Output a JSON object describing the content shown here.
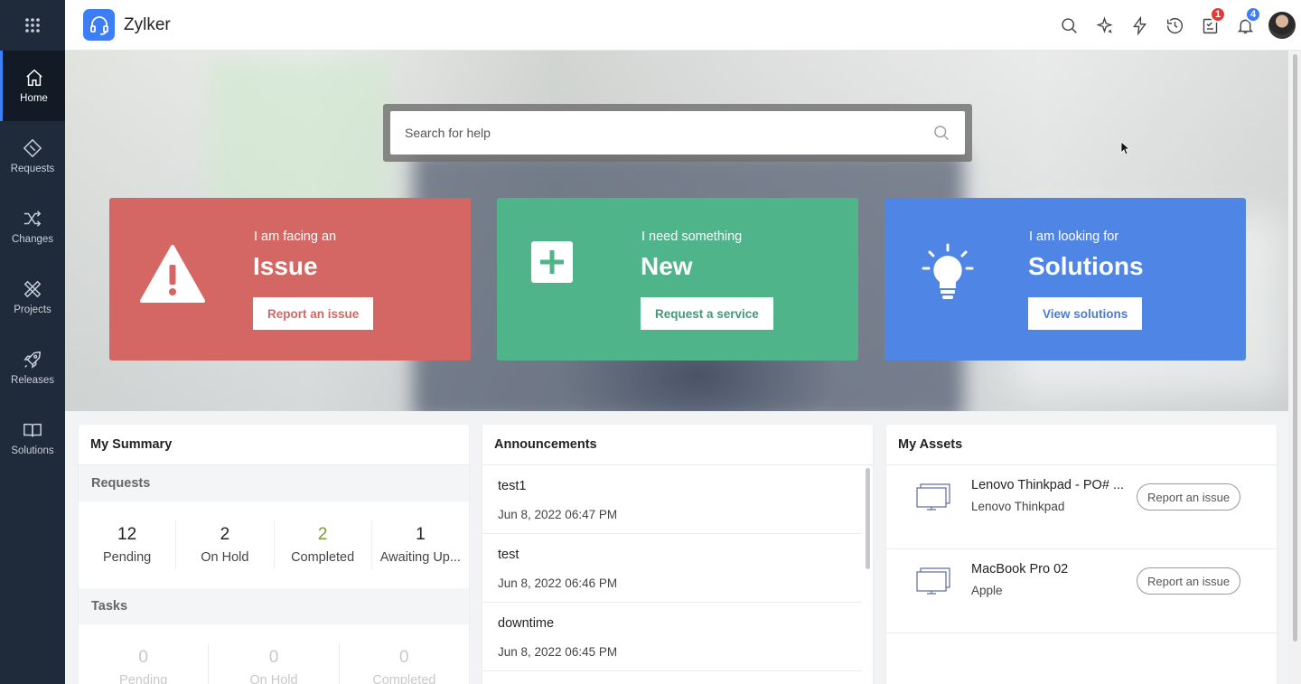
{
  "app": {
    "name": "Zylker"
  },
  "sidebar": {
    "items": [
      {
        "label": "Home",
        "icon": "home-icon",
        "active": true
      },
      {
        "label": "Requests",
        "icon": "ticket-icon"
      },
      {
        "label": "Changes",
        "icon": "shuffle-icon"
      },
      {
        "label": "Projects",
        "icon": "projects-icon"
      },
      {
        "label": "Releases",
        "icon": "rocket-icon"
      },
      {
        "label": "Solutions",
        "icon": "book-icon"
      }
    ]
  },
  "topbar": {
    "icons": [
      "search-icon",
      "sparkle-icon",
      "lightning-icon",
      "history-icon",
      "tasks-icon",
      "bell-icon"
    ],
    "tasks_badge": "1",
    "notifications_badge": "4"
  },
  "hero": {
    "search": {
      "placeholder": "Search for help"
    },
    "cards": {
      "issue": {
        "subtitle": "I am facing an",
        "title": "Issue",
        "button": "Report an issue",
        "color": "#d46763"
      },
      "new": {
        "subtitle": "I need something",
        "title": "New",
        "button": "Request a service",
        "color": "#4fb489"
      },
      "solutions": {
        "subtitle": "I am looking for",
        "title": "Solutions",
        "button": "View solutions",
        "color": "#4f86e6"
      }
    }
  },
  "summary": {
    "title": "My Summary",
    "requests": {
      "heading": "Requests",
      "stats": [
        {
          "value": "12",
          "label": "Pending"
        },
        {
          "value": "2",
          "label": "On Hold"
        },
        {
          "value": "2",
          "label": "Completed"
        },
        {
          "value": "1",
          "label": "Awaiting Up..."
        }
      ]
    },
    "tasks": {
      "heading": "Tasks",
      "stats": [
        {
          "value": "0",
          "label": "Pending"
        },
        {
          "value": "0",
          "label": "On Hold"
        },
        {
          "value": "0",
          "label": "Completed"
        }
      ]
    }
  },
  "announcements": {
    "title": "Announcements",
    "items": [
      {
        "title": "test1",
        "date": "Jun 8, 2022 06:47 PM"
      },
      {
        "title": "test",
        "date": "Jun 8, 2022 06:46 PM"
      },
      {
        "title": "downtime",
        "date": "Jun 8, 2022 06:45 PM"
      }
    ]
  },
  "assets": {
    "title": "My Assets",
    "items": [
      {
        "name": "Lenovo Thinkpad - PO# ...",
        "model": "Lenovo Thinkpad",
        "button": "Report an issue"
      },
      {
        "name": "MacBook Pro 02",
        "model": "Apple",
        "button": "Report an issue"
      }
    ]
  }
}
